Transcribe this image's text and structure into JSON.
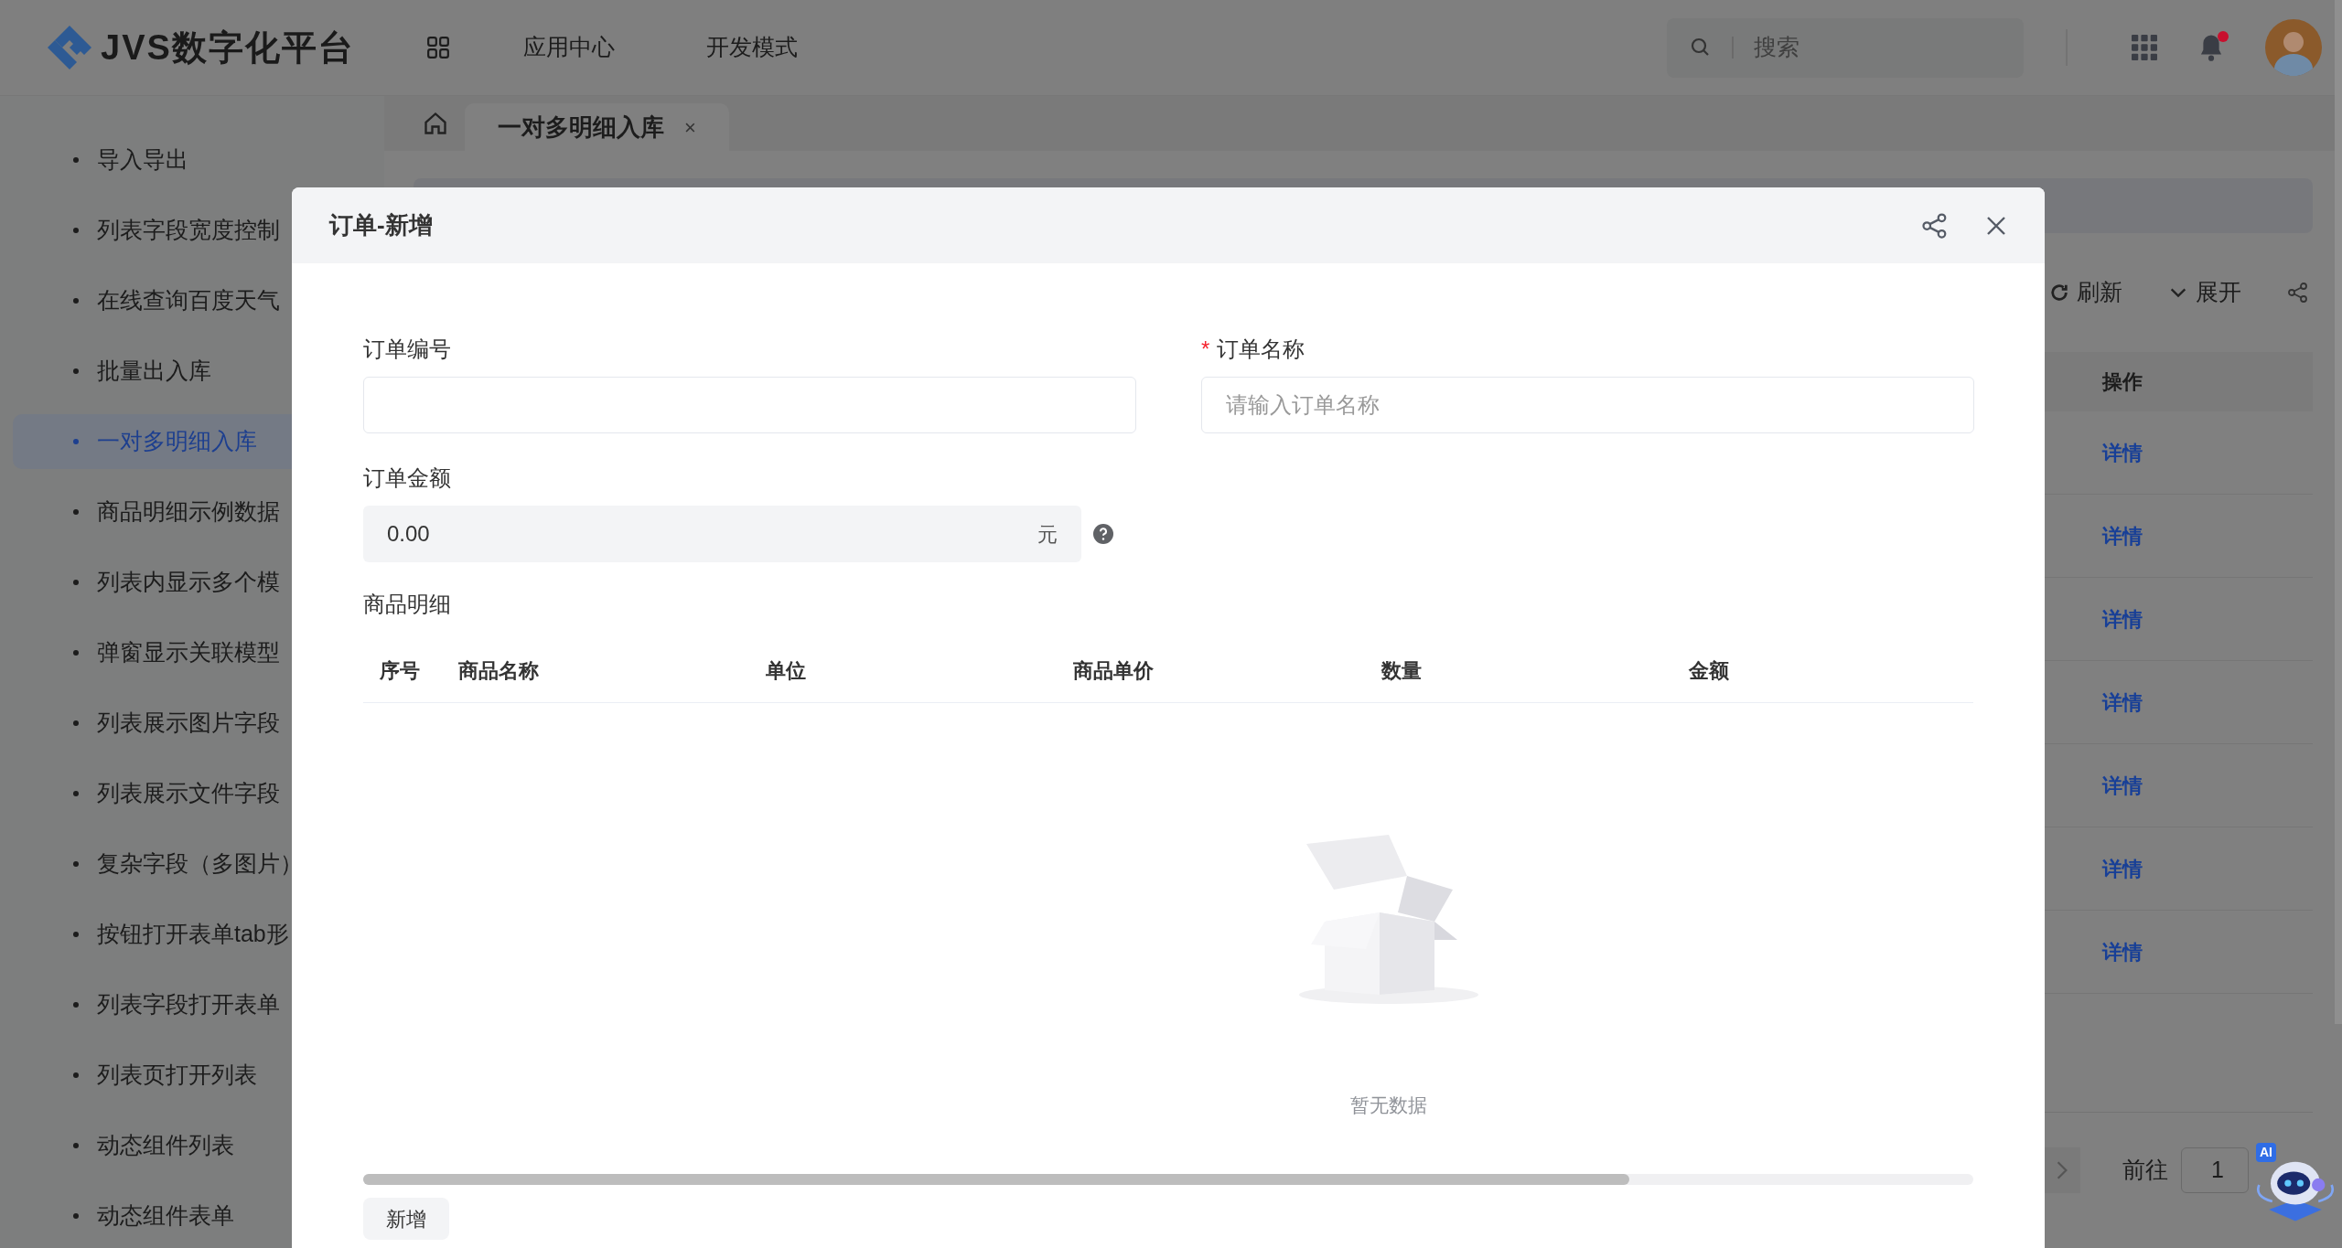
{
  "header": {
    "logo_text": "JVS数字化平台",
    "nav": [
      {
        "label": "应用中心"
      },
      {
        "label": "开发模式"
      }
    ],
    "search": {
      "placeholder": "搜索"
    },
    "notifications": {
      "unread": true
    }
  },
  "sidebar": {
    "items": [
      {
        "label": "导入导出",
        "selected": false
      },
      {
        "label": "列表字段宽度控制",
        "selected": false
      },
      {
        "label": "在线查询百度天气",
        "selected": false
      },
      {
        "label": "批量出入库",
        "selected": false
      },
      {
        "label": "一对多明细入库",
        "selected": true
      },
      {
        "label": "商品明细示例数据",
        "selected": false
      },
      {
        "label": "列表内显示多个模",
        "selected": false
      },
      {
        "label": "弹窗显示关联模型",
        "selected": false
      },
      {
        "label": "列表展示图片字段",
        "selected": false
      },
      {
        "label": "列表展示文件字段",
        "selected": false
      },
      {
        "label": "复杂字段（多图片）",
        "selected": false
      },
      {
        "label": "按钮打开表单tab形",
        "selected": false
      },
      {
        "label": "列表字段打开表单",
        "selected": false
      },
      {
        "label": "列表页打开列表",
        "selected": false
      },
      {
        "label": "动态组件列表",
        "selected": false
      },
      {
        "label": "动态组件表单",
        "selected": false
      }
    ]
  },
  "tabs": [
    {
      "label": "一对多明细入库",
      "selected": true,
      "close": "×"
    }
  ],
  "page": {
    "toolbar": [
      {
        "kind": "refresh",
        "label": "刷新"
      },
      {
        "kind": "expand",
        "label": "展开"
      }
    ],
    "table": {
      "columns": [
        "操作"
      ],
      "rows": [
        {
          "action": "详情"
        },
        {
          "action": "详情"
        },
        {
          "action": "详情"
        },
        {
          "action": "详情"
        },
        {
          "action": "详情"
        },
        {
          "action": "详情"
        },
        {
          "action": "详情"
        }
      ]
    },
    "pagination": {
      "goto_label": "前往",
      "page": "1"
    }
  },
  "assistant": {
    "badge": "AI"
  },
  "dialog": {
    "title": "订单-新增",
    "fields": [
      {
        "label": "订单编号",
        "required": false,
        "kind": "text"
      },
      {
        "label": "订单名称",
        "required": true,
        "required_mark": "*",
        "kind": "text",
        "placeholder": "请输入订单名称"
      },
      {
        "label": "订单金额",
        "required": false,
        "kind": "amount",
        "value": "0.00",
        "suffix": "元",
        "help": true
      }
    ],
    "detail": {
      "title": "商品明细",
      "columns": [
        "序号",
        "商品名称",
        "单位",
        "商品单价",
        "数量",
        "金额"
      ],
      "empty_text": "暂无数据"
    },
    "add_button": "新增"
  }
}
